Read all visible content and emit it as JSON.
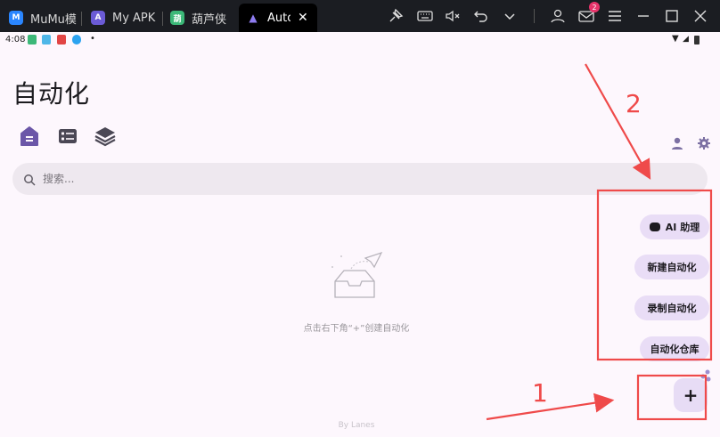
{
  "tabs": [
    {
      "label": "MuMu模",
      "icon": "mumu-icon",
      "color": "#2a86ff"
    },
    {
      "label": "My APK",
      "icon": "apk-icon",
      "color": "#6b5bd6"
    },
    {
      "label": "葫芦侠",
      "icon": "huluxia-icon",
      "color": "#3cb878"
    },
    {
      "label": "Auto",
      "icon": "auto-icon",
      "color": "#8e7cf0"
    }
  ],
  "window": {
    "notification_count": "2"
  },
  "status": {
    "time": "4:08",
    "dot": "•"
  },
  "app": {
    "title": "自动化",
    "search_placeholder": "搜索...",
    "empty_text": "点击右下角“+”创建自动化",
    "footer": "By Lanes",
    "accent": "#6b56a8"
  },
  "menu": {
    "ai_label": "AI 助理",
    "new_label": "新建自动化",
    "record_label": "录制自动化",
    "repo_label": "自动化仓库",
    "fab_label": "+"
  },
  "annotations": {
    "label1": "1",
    "label2": "2",
    "color": "#ef4a4a"
  }
}
